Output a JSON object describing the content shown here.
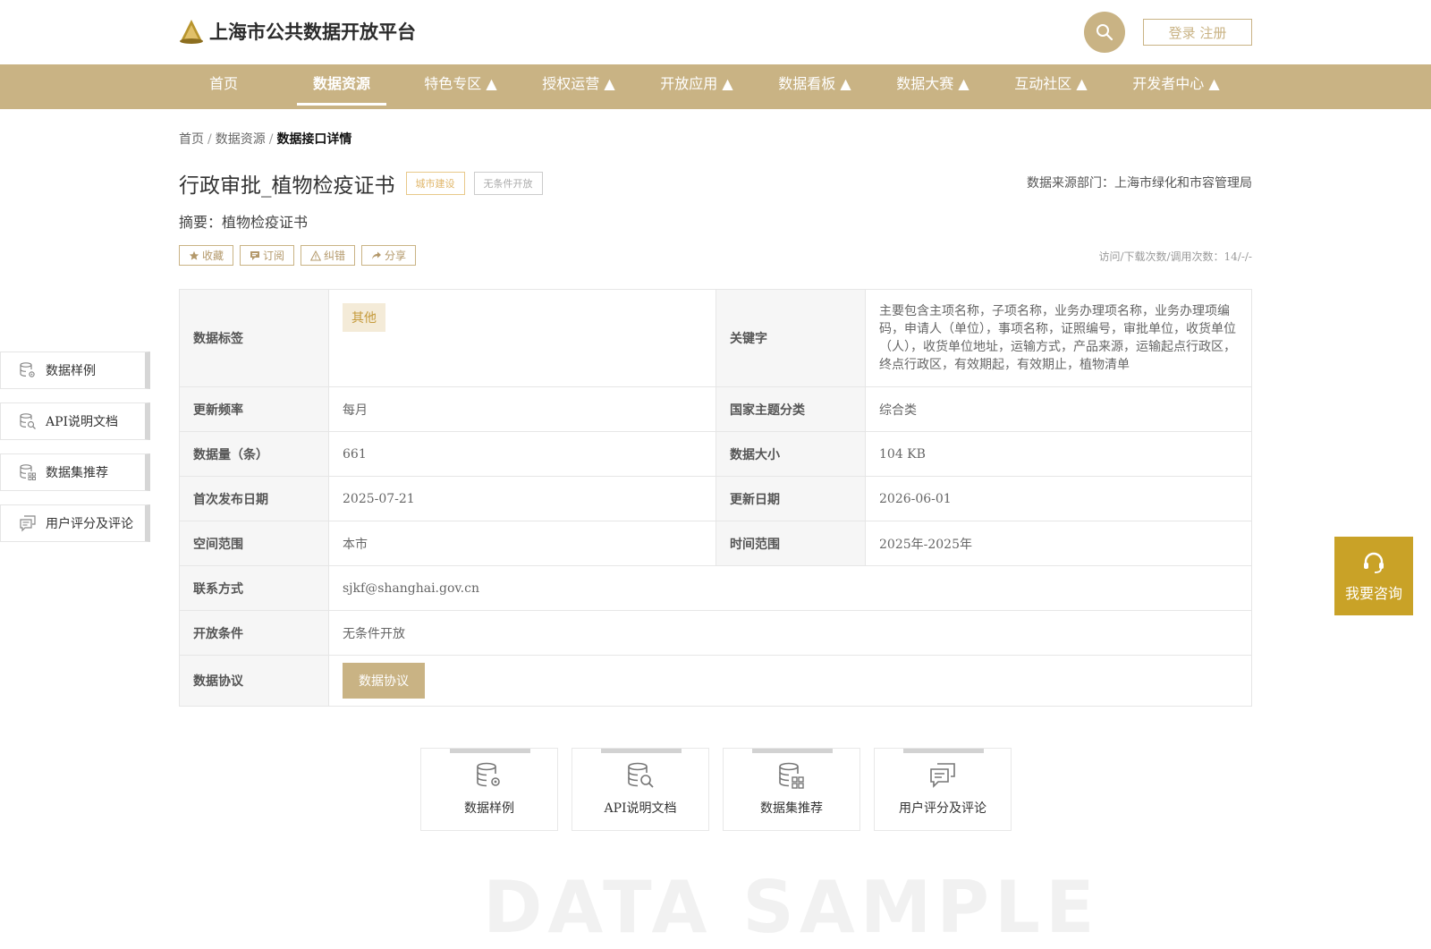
{
  "header": {
    "logo_text": "上海市公共数据开放平台",
    "login_label": "登录 注册"
  },
  "nav": {
    "items": [
      {
        "label": "首页"
      },
      {
        "label": "数据资源"
      },
      {
        "label": "特色专区 ▲"
      },
      {
        "label": "授权运营 ▲"
      },
      {
        "label": "开放应用 ▲"
      },
      {
        "label": "数据看板 ▲"
      },
      {
        "label": "数据大赛 ▲"
      },
      {
        "label": "互动社区 ▲"
      },
      {
        "label": "开发者中心 ▲"
      }
    ],
    "active_index": 1
  },
  "breadcrumb": {
    "home": "首页",
    "sep1": "/",
    "resources": "数据资源",
    "sep2": "/",
    "current": "数据接口详情"
  },
  "detail": {
    "title": "行政审批_植物检疫证书",
    "tag_category": "城市建设",
    "tag_open": "无条件开放",
    "source_dept": "数据来源部门：上海市绿化和市容管理局",
    "summary": "摘要：植物检疫证书",
    "visit_stats": "访问/下载次数/调用次数：14/-/-"
  },
  "actions": {
    "favorite": "收藏",
    "subscribe": "订阅",
    "report": "纠错",
    "share": "分享"
  },
  "sidebar": {
    "items": [
      {
        "label": "数据样例"
      },
      {
        "label": "API说明文档"
      },
      {
        "label": "数据集推荐"
      },
      {
        "label": "用户评分及评论"
      }
    ]
  },
  "table": {
    "data_tag_label": "数据标签",
    "data_tag_value": "其他",
    "keyword_label": "关键字",
    "keyword_value": "主要包含主项名称，子项名称，业务办理项名称，业务办理项编码，申请人（单位），事项名称，证照编号，审批单位，收货单位（人），收货单位地址，运输方式，产品来源，运输起点行政区，终点行政区，有效期起，有效期止，植物清单",
    "update_freq_label": "更新频率",
    "update_freq_value": "每月",
    "national_theme_label": "国家主题分类",
    "national_theme_value": "综合类",
    "count_label": "数据量（条）",
    "count_value": "661",
    "size_label": "数据大小",
    "size_value": "104 KB",
    "first_pub_label": "首次发布日期",
    "first_pub_value": "2025-07-21",
    "update_date_label": "更新日期",
    "update_date_value": "2026-06-01",
    "spatial_label": "空间范围",
    "spatial_value": "本市",
    "time_range_label": "时间范围",
    "time_range_value": "2025年-2025年",
    "contact_label": "联系方式",
    "contact_value": "sjkf@shanghai.gov.cn",
    "open_cond_label": "开放条件",
    "open_cond_value": "无条件开放",
    "agreement_label": "数据协议",
    "agreement_button": "数据协议"
  },
  "consult": {
    "label": "我要咨询"
  },
  "cards": [
    {
      "label": "数据样例"
    },
    {
      "label": "API说明文档"
    },
    {
      "label": "数据集推荐"
    },
    {
      "label": "用户评分及评论"
    }
  ],
  "watermark": "DATA SAMPLE",
  "colors": {
    "brand_gold": "#c9b384",
    "consult_gold": "#c9a227",
    "tag_orange": "#e0b669"
  }
}
